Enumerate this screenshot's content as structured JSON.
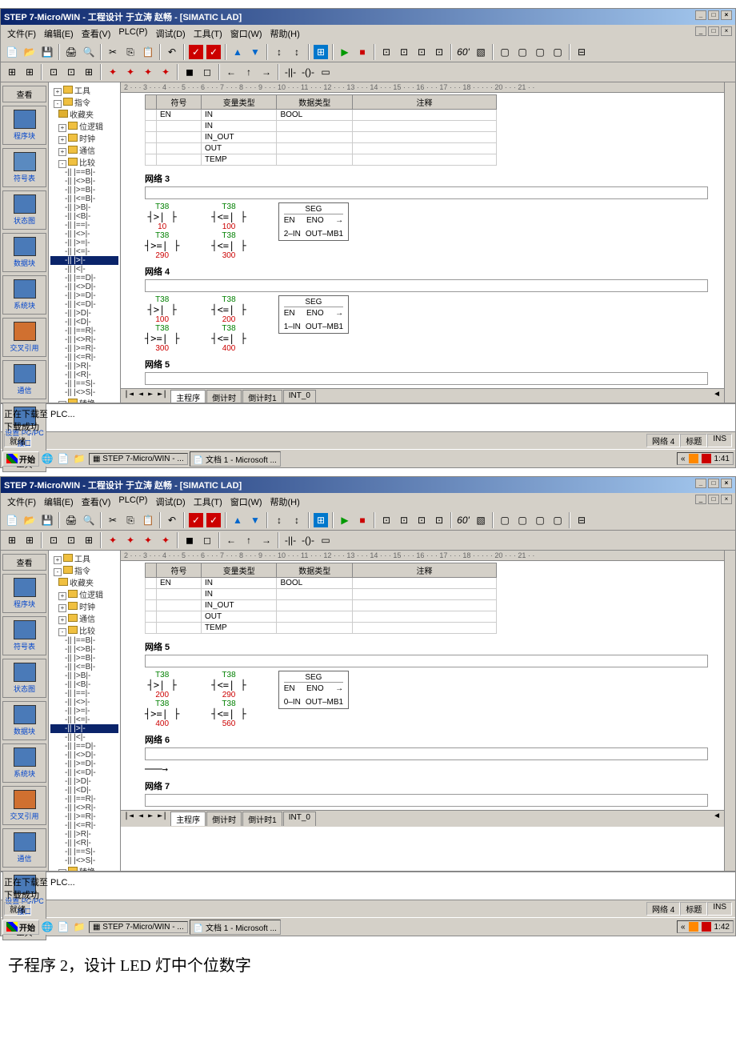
{
  "title_bar": "STEP 7-Micro/WIN - 工程设计 于立涛 赵畅 - [SIMATIC LAD]",
  "menu": {
    "file": "文件(F)",
    "edit": "编辑(E)",
    "view": "查看(V)",
    "plc": "PLC(P)",
    "debug": "调试(D)",
    "tools": "工具(T)",
    "window": "窗口(W)",
    "help": "帮助(H)"
  },
  "nav": {
    "header": "查看",
    "items": [
      "程序块",
      "符号表",
      "状态图",
      "数据块",
      "系统块",
      "交叉引用",
      "通信",
      "设置 PG/PC 接口"
    ],
    "footer": "工具"
  },
  "tree": {
    "root": "工具",
    "instr": "指令",
    "fav": "收藏夹",
    "bitlogic": "位逻辑",
    "clock": "时钟",
    "comm": "通信",
    "compare": "比较",
    "convert": "转换",
    "ops": [
      "-|| |==B|-",
      "-|| |<>B|-",
      "-|| |>=B|-",
      "-|| |<=B|-",
      "-|| |>B|-",
      "-|| |<B|-",
      "-|| |==|-",
      "-|| |<>|-",
      "-|| |>=|-",
      "-|| |<=|-",
      "-|| |>|-",
      "-|| |<|-",
      "-|| |==D|-",
      "-|| |<>D|-",
      "-|| |>=D|-",
      "-|| |<=D|-",
      "-|| |>D|-",
      "-|| |<D|-",
      "-|| |==R|-",
      "-|| |<>R|-",
      "-|| |>=R|-",
      "-|| |<=R|-",
      "-|| |>R|-",
      "-|| |<R|-",
      "-|| |==S|-",
      "-|| |<>S|-"
    ]
  },
  "ruler": "2 · · · 3 · · · 4 · · · 5 · · · 6 · · · 7 · · · 8 · · · 9 · · · 10 · · · 11 · · · 12 · · · 13 · · · 14 · · · 15 · · · 16 · · · 17 · · · 18 · · · · · 20 · · · 21 · ·",
  "var_table": {
    "headers": [
      "符号",
      "变量类型",
      "数据类型",
      "注释"
    ],
    "rows": [
      [
        "EN",
        "IN",
        "BOOL",
        ""
      ],
      [
        "",
        "IN",
        "",
        ""
      ],
      [
        "",
        "IN_OUT",
        "",
        ""
      ],
      [
        "",
        "OUT",
        "",
        ""
      ],
      [
        "",
        "TEMP",
        "",
        ""
      ]
    ]
  },
  "screenshot1": {
    "net3": {
      "label": "网络 3",
      "t1": "T38",
      "v1a": "10",
      "v1b": "100",
      "t2": "T38",
      "v2a": "290",
      "v2b": "300",
      "seg_in": "2",
      "seg_out": "MB1"
    },
    "net4": {
      "label": "网络 4",
      "t1": "T38",
      "v1a": "100",
      "v1b": "200",
      "t2": "T38",
      "v2a": "300",
      "v2b": "400",
      "seg_in": "1",
      "seg_out": "MB1"
    },
    "net5": {
      "label": "网络 5"
    }
  },
  "screenshot2": {
    "net5": {
      "label": "网络 5",
      "t1": "T38",
      "v1a": "200",
      "v1b": "290",
      "t2": "T38",
      "v2a": "400",
      "v2b": "560",
      "seg_in": "0",
      "seg_out": "MB1"
    },
    "net6": {
      "label": "网络 6"
    },
    "net7": {
      "label": "网络 7"
    }
  },
  "seg": {
    "title": "SEG",
    "en": "EN",
    "eno": "ENO",
    "in": "IN",
    "out": "OUT"
  },
  "tabs": {
    "nav": "|◄ ◄ ► ►|",
    "main": "主程序",
    "sub1": "倒计时",
    "sub2": "倒计时1",
    "int": "INT_0"
  },
  "messages": {
    "line1": "正在下载至 PLC...",
    "line2": "下载成功"
  },
  "status": {
    "ready": "就绪",
    "net": "网络 4",
    "col": "标题",
    "mode": "INS"
  },
  "taskbar": {
    "start": "开始",
    "task1": "STEP 7-Micro/WIN - ...",
    "task2": "文档 1 - Microsoft ...",
    "time1": "1:41",
    "time2": "1:42"
  },
  "caption": "子程序 2，设计 LED 灯中个位数字"
}
